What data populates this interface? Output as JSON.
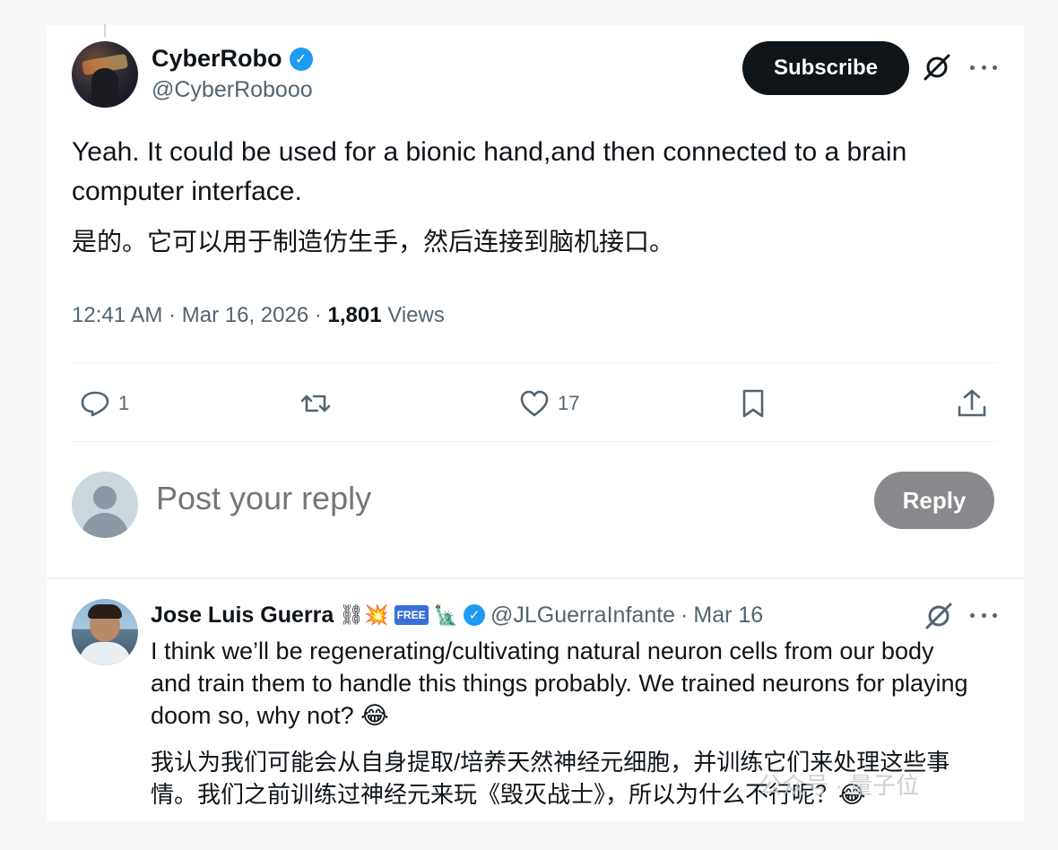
{
  "tweet": {
    "author_name": "CyberRobo",
    "author_handle": "@CyberRobooo",
    "subscribe_label": "Subscribe",
    "text_en": "Yeah. It could be used for a bionic hand,and then connected to a brain computer interface.",
    "text_zh": "是的。它可以用于制造仿生手，然后连接到脑机接口。",
    "time": "12:41 AM",
    "date": "Mar 16, 2026",
    "views_count": "1,801",
    "views_label": "Views",
    "sep": "·",
    "actions": {
      "reply_count": "1",
      "like_count": "17"
    }
  },
  "reply_box": {
    "placeholder": "Post your reply",
    "button_label": "Reply"
  },
  "reply_tweet": {
    "author_name": "Jose Luis Guerra",
    "badge_emojis": "⛓💥",
    "free_badge": "FREE",
    "statue_emoji": "🗽",
    "author_handle": "@JLGuerraInfante",
    "date": "Mar 16",
    "sep": "·",
    "text_en": "I think we’ll be regenerating/cultivating natural neuron cells from our body and train them to handle this things probably. We trained neurons for playing doom so, why not? 😂",
    "text_zh": "我认为我们可能会从自身提取/培养天然神经元细胞，并训练它们来处理这些事情。我们之前训练过神经元来玩《毁灭战士》，所以为什么不行呢？😂"
  },
  "watermark": "公众号 · 量子位",
  "icons": [
    "verified-badge-icon",
    "grok-icon",
    "more-icon",
    "reply-icon",
    "repost-icon",
    "like-icon",
    "bookmark-icon",
    "share-icon"
  ],
  "colors": {
    "accent": "#1d9bf0",
    "text": "#0f1419",
    "muted": "#536471",
    "button_dark": "#0f1419",
    "reply_disabled": "#87898c"
  }
}
